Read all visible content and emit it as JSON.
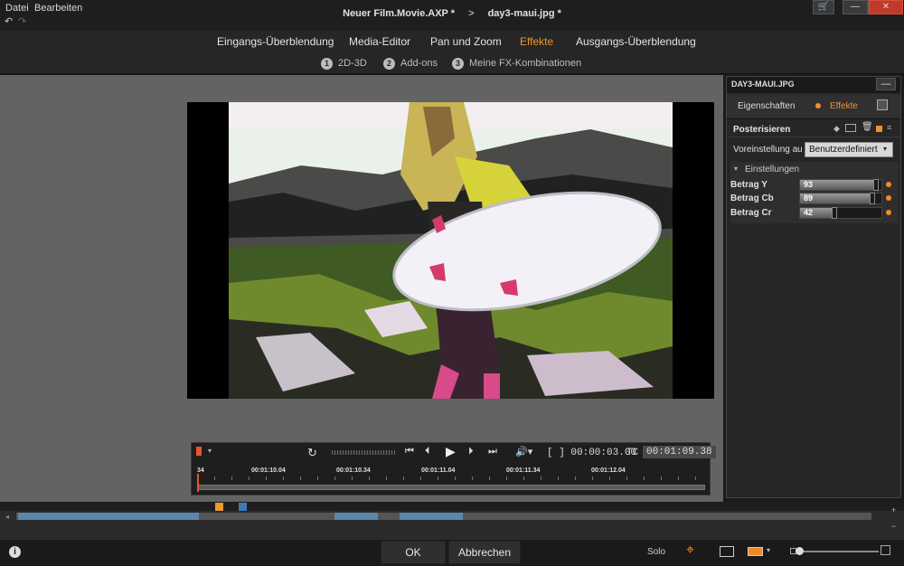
{
  "menu": {
    "file": "Datei",
    "edit": "Bearbeiten"
  },
  "titles": {
    "project": "Neuer Film.Movie.AXP *",
    "separator": ">",
    "clip": "day3-maui.jpg *"
  },
  "tabs": [
    {
      "label": "Eingangs-Überblendung"
    },
    {
      "label": "Media-Editor"
    },
    {
      "label": "Pan und Zoom"
    },
    {
      "label": "Effekte",
      "active": true
    },
    {
      "label": "Ausgangs-Überblendung"
    }
  ],
  "subtabs": [
    {
      "num": "1",
      "label": "2D-3D"
    },
    {
      "num": "2",
      "label": "Add-ons"
    },
    {
      "num": "3",
      "label": "Meine FX-Kombinationen"
    }
  ],
  "transport": {
    "duration": "[ ] 00:00:03.00",
    "tc_label": "TC",
    "timecode": "00:01:09.38",
    "ruler_start": "34",
    "ruler_labels": [
      "00:01:10.04",
      "00:01:10.34",
      "00:01:11.04",
      "00:01:11.34",
      "00:01:12.04"
    ]
  },
  "panel": {
    "header": "DAY3-MAUI.JPG",
    "tab_properties": "Eigenschaften",
    "tab_effects": "Effekte",
    "effect_name": "Posterisieren",
    "preset_label": "Voreinstellung au",
    "preset_value": "Benutzerdefiniert",
    "section_label": "Einstellungen",
    "sliders": [
      {
        "label": "Betrag Y",
        "value": "93",
        "fraction": 0.93
      },
      {
        "label": "Betrag Cb",
        "value": "89",
        "fraction": 0.89
      },
      {
        "label": "Betrag Cr",
        "value": "42",
        "fraction": 0.42
      }
    ]
  },
  "bottom": {
    "ok": "OK",
    "cancel": "Abbrechen",
    "solo": "Solo"
  },
  "colors": {
    "accent": "#f0922b",
    "slider_dot": "#f08a24"
  }
}
